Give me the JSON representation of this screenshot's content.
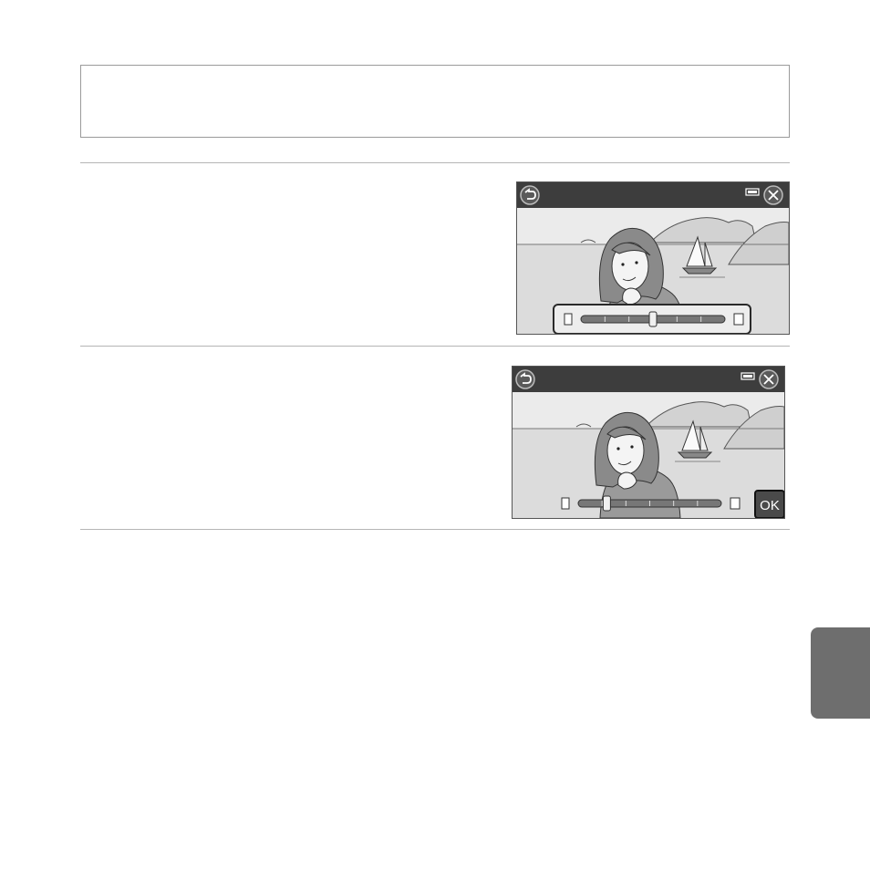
{
  "page": {
    "note_box_text": "",
    "side_tab_label": ""
  },
  "screens": [
    {
      "name": "screen-step-adjust",
      "slider_value": 0.5,
      "slider_highlighted": true,
      "ok_visible": false,
      "ok_label": "OK"
    },
    {
      "name": "screen-step-confirm",
      "slider_value": 0.2,
      "slider_highlighted": false,
      "ok_visible": true,
      "ok_label": "OK"
    }
  ],
  "colors": {
    "header_bar": "#3d3d3d",
    "button_fill": "#5a5a5a",
    "side_tab": "#6e6e6e",
    "highlight_border": "#2a2a2a"
  },
  "icons": {
    "back": "back-arrow-icon",
    "close": "close-icon",
    "battery": "battery-icon",
    "slider_low": "slider-min-icon",
    "slider_high": "slider-max-icon"
  }
}
